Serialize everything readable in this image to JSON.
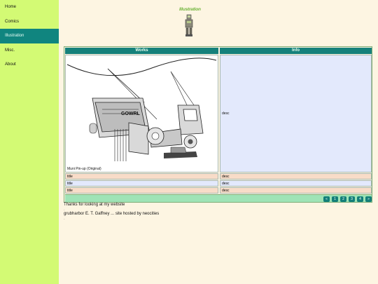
{
  "sidebar": {
    "items": [
      {
        "label": "Home"
      },
      {
        "label": "Comics"
      },
      {
        "label": "Illustration"
      },
      {
        "label": "Misc."
      },
      {
        "label": "About"
      }
    ]
  },
  "header": {
    "logo_text": "Illustration"
  },
  "table": {
    "columns": [
      "Works",
      "Info"
    ],
    "feature": {
      "caption": "Muni Pin-up (Original)",
      "desc": "desc"
    },
    "rows": [
      {
        "title": "title",
        "desc": "desc"
      },
      {
        "title": "title",
        "desc": "desc"
      },
      {
        "title": "title",
        "desc": "desc"
      }
    ]
  },
  "pager": {
    "prev": "«",
    "pages": [
      "1",
      "2",
      "3",
      "4"
    ],
    "next": "»"
  },
  "footer": {
    "thanks": "Thanks for looking at my website",
    "dash1": "-",
    "credit": "grubharbor E. T. Gaffney ... site hosted by neocities",
    "dash2": "-"
  },
  "colors": {
    "sidebar_bg": "#d3fa74",
    "accent": "#10857f",
    "page_bg": "#fdf5e2"
  }
}
